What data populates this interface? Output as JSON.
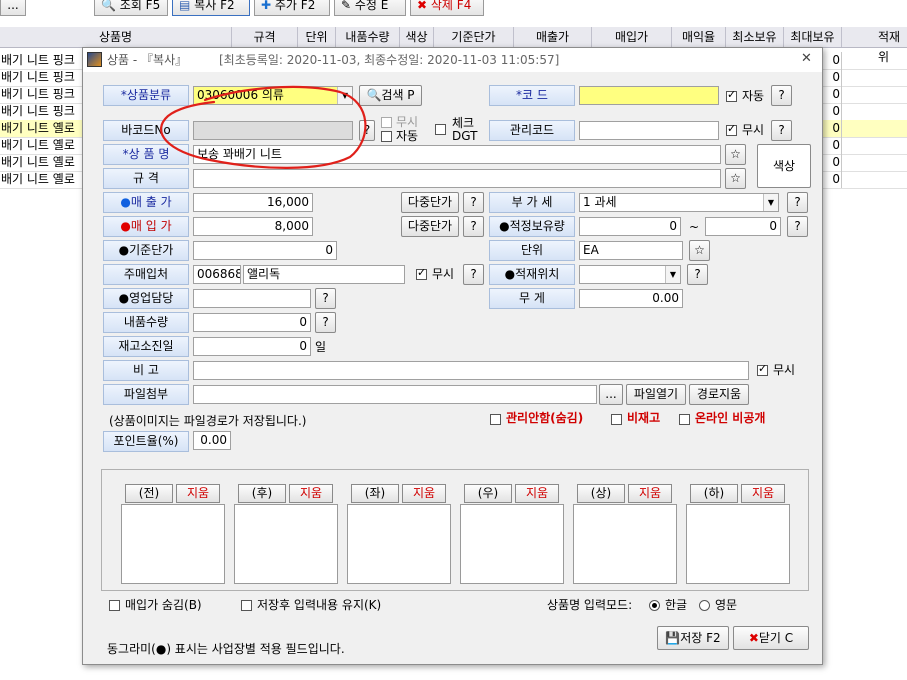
{
  "toolbar": {
    "more_label": "...",
    "query_label": "조회 F5",
    "copy_label": "복사 F2",
    "add_label": "추가 F2",
    "edit_label": "수정 E",
    "delete_label": "삭제 F4"
  },
  "grid": {
    "headers": [
      "상품명",
      "규격",
      "단위",
      "내품수량",
      "색상",
      "기준단가",
      "매출가",
      "매입가",
      "매익율",
      "최소보유",
      "최대보유",
      "적재위"
    ],
    "rows": [
      {
        "name": "배기 니트 핑크",
        "max": "0"
      },
      {
        "name": "배기 니트 핑크",
        "max": "0"
      },
      {
        "name": "배기 니트 핑크",
        "max": "0"
      },
      {
        "name": "배기 니트 핑크",
        "max": "0"
      },
      {
        "name": "배기 니트 옐로",
        "max": "0"
      },
      {
        "name": "배기 니트 옐로",
        "max": "0"
      },
      {
        "name": "배기 니트 옐로",
        "max": "0"
      },
      {
        "name": "배기 니트 옐로",
        "max": "0"
      }
    ]
  },
  "dialog": {
    "title": "상품 - 『복사』",
    "dates": "[최초등록일: 2020-11-03, 최종수정일: 2020-11-03 11:05:57]",
    "close_glyph": "✕",
    "category_label": "*상품분류",
    "category_value": "03060006 의류",
    "search_button": "검색 P",
    "code_label": "*코    드",
    "code_value": "",
    "auto_label": "자동",
    "q": "?",
    "barcode_label": "바코드No",
    "barcode_ignore": "무시",
    "barcode_auto": "자동",
    "check_dgt_line1": "체크",
    "check_dgt_line2": "DGT",
    "mgmt_code_label": "관리코드",
    "mgmt_ignore": "무시",
    "name_label": "*상 품 명",
    "name_value": "보송 꽈배기 니트",
    "star": "☆",
    "color_button": "색상",
    "spec_label": "규    격",
    "spec_value": "",
    "sale_price_label": "매 출 가",
    "sale_price_value": "16,000",
    "buy_price_label": "매 입 가",
    "buy_price_value": "8,000",
    "multi_price_label": "다중단가",
    "vat_label": "부 가 세",
    "vat_value": "1 과세",
    "stock_label": "●적정보유량",
    "stock_min": "0",
    "stock_tilde": "~",
    "stock_max": "0",
    "base_price_label": "●기준단가",
    "base_price_value": "0",
    "unit_label": "단위",
    "unit_value": "EA",
    "supplier_label": "주매입처",
    "supplier_code": "006868",
    "supplier_name": "앨리독",
    "supplier_ignore": "무시",
    "location_label": "●적재위치",
    "location_value": "",
    "sales_rep_label": "●영업담당",
    "sales_rep_value": "",
    "weight_label": "무    게",
    "weight_value": "0.00",
    "inner_qty_label": "내품수량",
    "inner_qty_value": "0",
    "depletion_label": "재고소진일",
    "depletion_value": "0",
    "depletion_unit": "일",
    "memo_label": "비    고",
    "memo_value": "",
    "memo_ignore": "무시",
    "attach_label": "파일첨부",
    "attach_value": "",
    "browse_button": "...",
    "open_file_button": "파일열기",
    "clear_path_button": "경로지움",
    "image_note": "(상품이미지는 파일경로가 저장됩니다.)",
    "unmanaged_label": "관리안함(숨김)",
    "non_stock_label": "비재고",
    "online_private_label": "온라인 비공개",
    "point_rate_label": "포인트율(%)",
    "point_rate_value": "0.00",
    "image_slots": [
      {
        "dir": "(전)",
        "clear": "지움"
      },
      {
        "dir": "(후)",
        "clear": "지움"
      },
      {
        "dir": "(좌)",
        "clear": "지움"
      },
      {
        "dir": "(우)",
        "clear": "지움"
      },
      {
        "dir": "(상)",
        "clear": "지움"
      },
      {
        "dir": "(하)",
        "clear": "지움"
      }
    ],
    "hide_buy_price_label": "매입가 숨김(B)",
    "keep_input_label": "저장후 입력내용 유지(K)",
    "input_mode_label": "상품명 입력모드:",
    "mode_korean": "한글",
    "mode_english": "영문",
    "footer_note": "동그라미(●) 표시는 사업장별 적용 필드입니다.",
    "save_button": "저장 F2",
    "close_button": "닫기 C"
  },
  "colors": {
    "required_field": "#ffff80",
    "label_bg": "#dce8f8",
    "required_text": "#1a2aa0",
    "annotation_red": "#e0201a",
    "selected_row": "#ffffc0"
  }
}
